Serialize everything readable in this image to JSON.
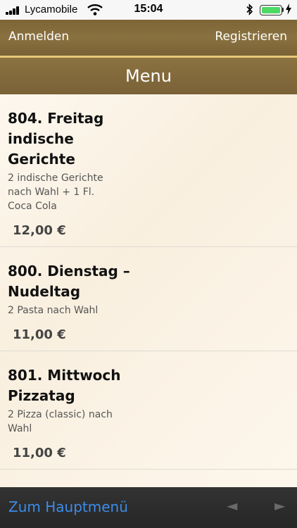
{
  "status": {
    "carrier": "Lycamobile",
    "time": "15:04",
    "signal_bars": 4,
    "battery_level": 1.0
  },
  "header": {
    "login_label": "Anmelden",
    "register_label": "Registrieren",
    "title": "Menu"
  },
  "menu": {
    "items": [
      {
        "title": "804. Freitag indische Gerichte",
        "description": "2 indische Gerichte nach Wahl + 1 Fl. Coca Cola",
        "price": "12,00 €"
      },
      {
        "title": "800. Dienstag – Nudeltag",
        "description": "2 Pasta nach Wahl",
        "price": "11,00 €"
      },
      {
        "title": "801. Mittwoch Pizzatag",
        "description": "2 Pizza (classic) nach Wahl",
        "price": "11,00 €"
      }
    ]
  },
  "footer": {
    "home_label": "Zum Hauptmenü",
    "back_icon": "◄",
    "forward_icon": "►"
  },
  "colors": {
    "header_brown": "#7d6537",
    "gold_accent": "#e8c87a",
    "link_blue": "#3c8ce8",
    "battery_green": "#4cd964"
  }
}
